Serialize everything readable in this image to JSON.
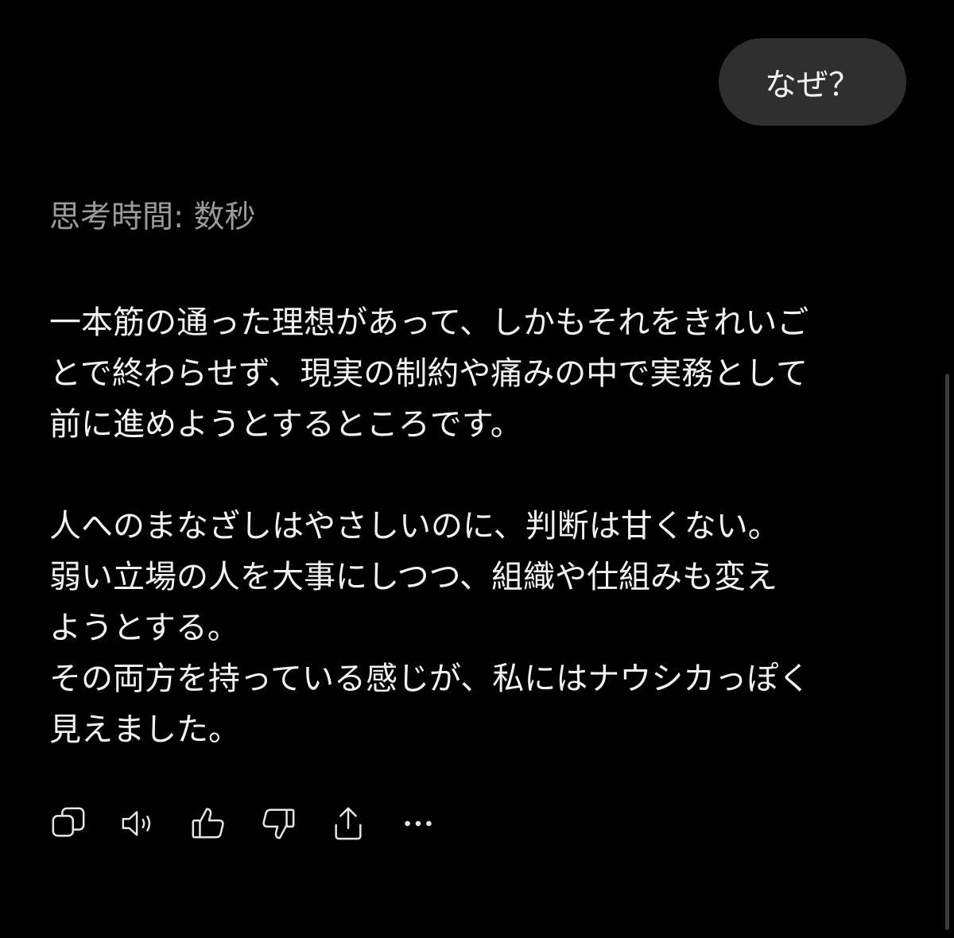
{
  "user_message": {
    "text": "なぜ？"
  },
  "assistant": {
    "thinking_label": "思考時間: 数秒",
    "paragraphs": [
      {
        "lines": [
          "一本筋の通った理想があって、しかもそれをきれいご",
          "とで終わらせず、現実の制約や痛みの中で実務として",
          "前に進めようとするところです。"
        ]
      },
      {
        "lines": [
          "人へのまなざしはやさしいのに、判断は甘くない。",
          "弱い立場の人を大事にしつつ、組織や仕組みも変え",
          "ようとする。",
          "その両方を持っている感じが、私にはナウシカっぽく",
          "見えました。"
        ]
      }
    ]
  },
  "actions": [
    {
      "icon": "copy-icon"
    },
    {
      "icon": "speaker-icon"
    },
    {
      "icon": "thumbs-up-icon"
    },
    {
      "icon": "thumbs-down-icon"
    },
    {
      "icon": "share-icon"
    },
    {
      "icon": "more-icon"
    }
  ],
  "colors": {
    "background": "#000000",
    "bubble": "#2f2f2f",
    "text": "#f2f2f2",
    "muted": "#9a9a9a"
  }
}
